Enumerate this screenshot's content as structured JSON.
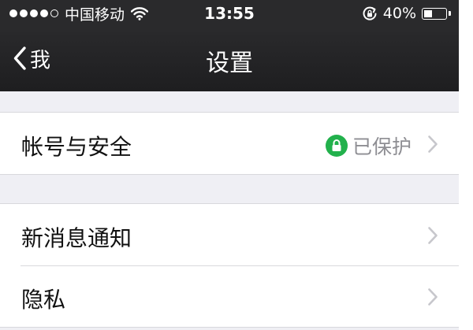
{
  "status_bar": {
    "carrier": "中国移动",
    "time": "13:55",
    "battery_percent": "40%",
    "battery_level": 0.4,
    "signal_bars_filled": 4,
    "signal_bars_total": 5
  },
  "nav": {
    "back_label": "我",
    "title": "设置"
  },
  "groups": [
    {
      "rows": [
        {
          "label": "帐号与安全",
          "detail": "已保护",
          "detail_icon": "lock-icon"
        }
      ]
    },
    {
      "rows": [
        {
          "label": "新消息通知",
          "detail": ""
        },
        {
          "label": "隐私",
          "detail": ""
        }
      ]
    }
  ],
  "colors": {
    "nav_background": "#2a2a2c",
    "page_background": "#efeff4",
    "protected_badge": "#22b14c",
    "secondary_text": "#8e8e93"
  }
}
